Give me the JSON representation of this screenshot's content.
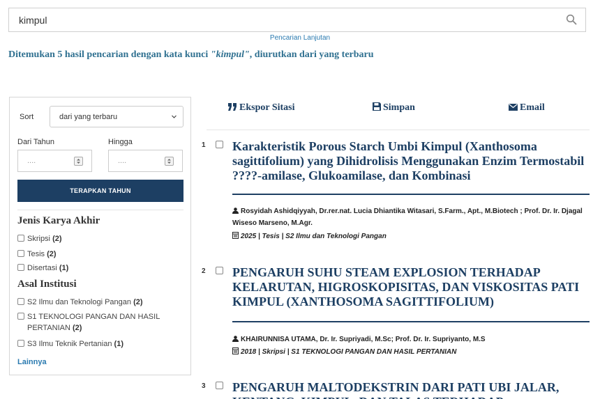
{
  "search": {
    "value": "kimpul",
    "advanced_link": "Pencarian Lanjutan"
  },
  "summary": {
    "prefix": "Ditemukan 5 hasil pencarian dengan kata kunci ",
    "keyword": "\"kimpul\"",
    "suffix": ", diurutkan dari yang terbaru"
  },
  "sidebar": {
    "sort_label": "Sort",
    "sort_value": "dari yang terbaru",
    "from_label": "Dari Tahun",
    "to_label": "Hingga",
    "from_placeholder": "....",
    "to_placeholder": "....",
    "apply_button": "TERAPKAN TAHUN",
    "facets": [
      {
        "title": "Jenis Karya Akhir",
        "items": [
          {
            "label": "Skripsi",
            "count": "(2)"
          },
          {
            "label": "Tesis",
            "count": "(2)"
          },
          {
            "label": "Disertasi",
            "count": "(1)"
          }
        ]
      },
      {
        "title": "Asal Institusi",
        "items": [
          {
            "label": "S2 Ilmu dan Teknologi Pangan",
            "count": "(2)"
          },
          {
            "label": "S1 TEKNOLOGI PANGAN DAN HASIL",
            "label2": "PERTANIAN",
            "count": "(2)"
          },
          {
            "label": "S3 Ilmu Teknik Pertanian",
            "count": "(1)"
          }
        ]
      }
    ],
    "more_link": "Lainnya"
  },
  "toolbar": {
    "export": "Ekspor Sitasi",
    "save": "Simpan",
    "email": "Email"
  },
  "results": [
    {
      "num": "1",
      "title": "Karakteristik Porous Starch Umbi Kimpul (Xanthosoma sagittifolium) yang Dihidrolisis Menggunakan Enzim Termostabil ????-amilase, Glukoamilase, dan Kombinasi",
      "authors": "Rosyidah Ashidqiyyah, Dr.rer.nat. Lucia Dhiantika Witasari, S.Farm., Apt., M.Biotech ; Prof. Dr. Ir. Djagal Wiseso Marseno, M.Agr.",
      "meta": "2025 | Tesis | S2 Ilmu dan Teknologi Pangan"
    },
    {
      "num": "2",
      "title": "PENGARUH SUHU STEAM EXPLOSION TERHADAP KELARUTAN, HIGROSKOPISITAS, DAN VISKOSITAS PATI KIMPUL (XANTHOSOMA SAGITTIFOLIUM)",
      "authors": "KHAIRUNNISA UTAMA, Dr. Ir. Supriyadi, M.Sc; Prof. Dr. Ir. Supriyanto, M.S",
      "meta": "2018 | Skripsi | S1 TEKNOLOGI PANGAN DAN HASIL PERTANIAN"
    },
    {
      "num": "3",
      "title": "PENGARUH MALTODEKSTRIN DARI PATI UBI JALAR, KENTANG, KIMPUL, DAN TALAS TERHADAP"
    }
  ]
}
